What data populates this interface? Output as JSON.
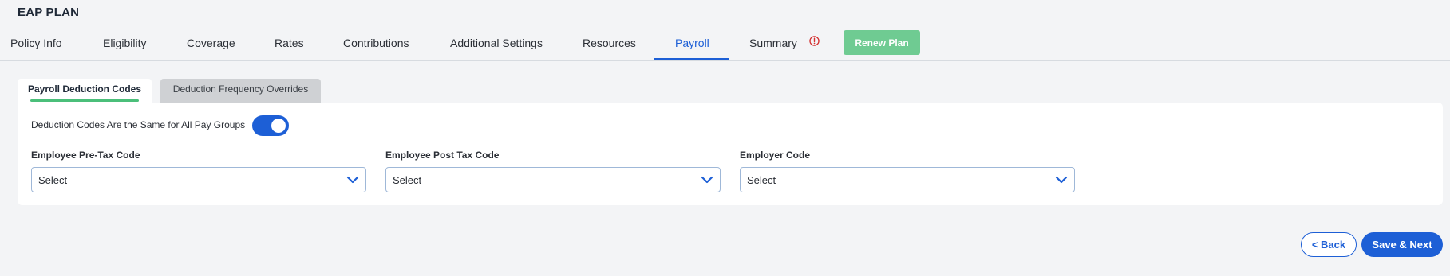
{
  "plan": {
    "title": "EAP PLAN"
  },
  "tabs": [
    {
      "label": "Policy Info"
    },
    {
      "label": "Eligibility"
    },
    {
      "label": "Coverage"
    },
    {
      "label": "Rates"
    },
    {
      "label": "Contributions"
    },
    {
      "label": "Additional Settings"
    },
    {
      "label": "Resources"
    },
    {
      "label": "Payroll",
      "active": true
    },
    {
      "label": "Summary",
      "icon": "warning-circle-icon"
    }
  ],
  "renew_button": "Renew Plan",
  "subtabs": {
    "active": "Payroll Deduction Codes",
    "inactive": "Deduction Frequency Overrides"
  },
  "toggle": {
    "label": "Deduction Codes Are the Same for All Pay Groups",
    "on": true
  },
  "fields": [
    {
      "label": "Employee Pre-Tax Code",
      "value": "Select"
    },
    {
      "label": "Employee Post Tax Code",
      "value": "Select"
    },
    {
      "label": "Employer Code",
      "value": "Select"
    }
  ],
  "footer": {
    "back_label": "< Back",
    "next_label": "Save & Next"
  },
  "colors": {
    "accent": "#1d5fd6",
    "renew": "#6fcb92",
    "warning": "#d32f2f",
    "active_subtab_underline": "#4bbf7a"
  }
}
